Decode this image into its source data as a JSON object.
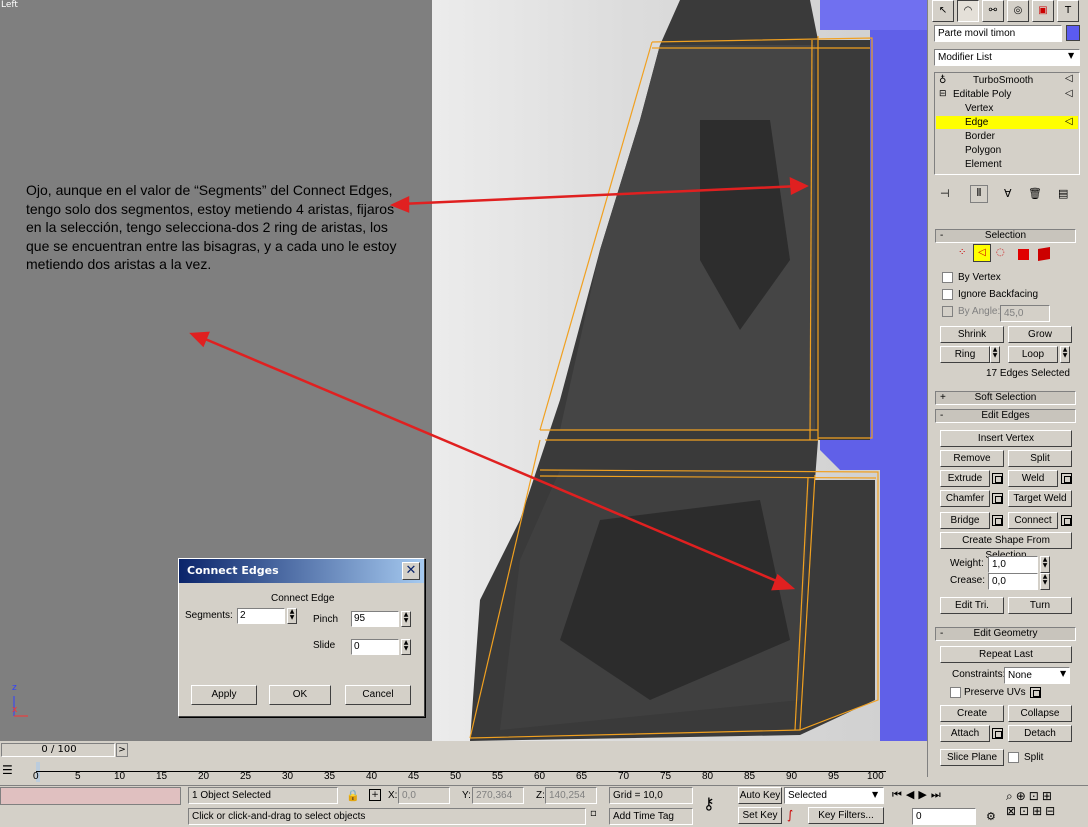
{
  "viewport": {
    "label": "Left",
    "annotation": "Ojo, aunque en el valor de “Segments” del Connect Edges, tengo solo dos segmentos, estoy metiendo 4 aristas, fijaros en la selección, tengo selecciona-dos 2 ring de aristas, los que se encuentran entre las bisagras, y a cada uno le estoy metiendo dos aristas a la vez.",
    "axis_z": "z",
    "axis_x": "x"
  },
  "dialog": {
    "title": "Connect Edges",
    "group_label": "Connect Edge",
    "segments_label": "Segments:",
    "segments_value": "2",
    "pinch_label": "Pinch",
    "pinch_value": "95",
    "slide_label": "Slide",
    "slide_value": "0",
    "apply": "Apply",
    "ok": "OK",
    "cancel": "Cancel"
  },
  "panel": {
    "object_name": "Parte movil timon",
    "object_color": "#5b5bf0",
    "modifier_list": "Modifier List",
    "stack": [
      {
        "label": "TurboSmooth",
        "level": 0
      },
      {
        "label": "Editable Poly",
        "level": 0
      },
      {
        "label": "Vertex",
        "level": 1
      },
      {
        "label": "Edge",
        "level": 1,
        "selected": true
      },
      {
        "label": "Border",
        "level": 1
      },
      {
        "label": "Polygon",
        "level": 1
      },
      {
        "label": "Element",
        "level": 1
      }
    ],
    "selection": {
      "title": "Selection",
      "by_vertex": "By Vertex",
      "ignore_backfacing": "Ignore Backfacing",
      "by_angle": "By Angle:",
      "by_angle_value": "45,0",
      "shrink": "Shrink",
      "grow": "Grow",
      "ring": "Ring",
      "loop": "Loop",
      "status": "17 Edges Selected"
    },
    "soft_selection": "Soft Selection",
    "edit_edges": {
      "title": "Edit Edges",
      "insert_vertex": "Insert Vertex",
      "remove": "Remove",
      "split": "Split",
      "extrude": "Extrude",
      "weld": "Weld",
      "chamfer": "Chamfer",
      "target_weld": "Target Weld",
      "bridge": "Bridge",
      "connect": "Connect",
      "create_shape": "Create Shape From Selection",
      "weight_label": "Weight:",
      "weight_value": "1,0",
      "crease_label": "Crease:",
      "crease_value": "0,0",
      "edit_tri": "Edit Tri.",
      "turn": "Turn"
    },
    "edit_geometry": {
      "title": "Edit Geometry",
      "repeat_last": "Repeat Last",
      "constraints_label": "Constraints:",
      "constraints_value": "None",
      "preserve_uvs": "Preserve UVs",
      "create": "Create",
      "collapse": "Collapse",
      "attach": "Attach",
      "detach": "Detach",
      "slice_plane": "Slice Plane",
      "split": "Split"
    }
  },
  "timeline": {
    "frame": "0 / 100",
    "ticks": [
      "0",
      "5",
      "10",
      "15",
      "20",
      "25",
      "30",
      "35",
      "40",
      "45",
      "50",
      "55",
      "60",
      "65",
      "70",
      "75",
      "80",
      "85",
      "90",
      "95",
      "100"
    ]
  },
  "status": {
    "selected": "1 Object Selected",
    "prompt": "Click or click-and-drag to select objects",
    "x_label": "X:",
    "x_value": "0,0",
    "y_label": "Y:",
    "y_value": "270,364",
    "z_label": "Z:",
    "z_value": "140,254",
    "grid": "Grid = 10,0",
    "add_time_tag": "Add Time Tag",
    "auto_key": "Auto Key",
    "set_key": "Set Key",
    "selected_filter": "Selected",
    "key_filters": "Key Filters...",
    "frame_field": "0"
  }
}
